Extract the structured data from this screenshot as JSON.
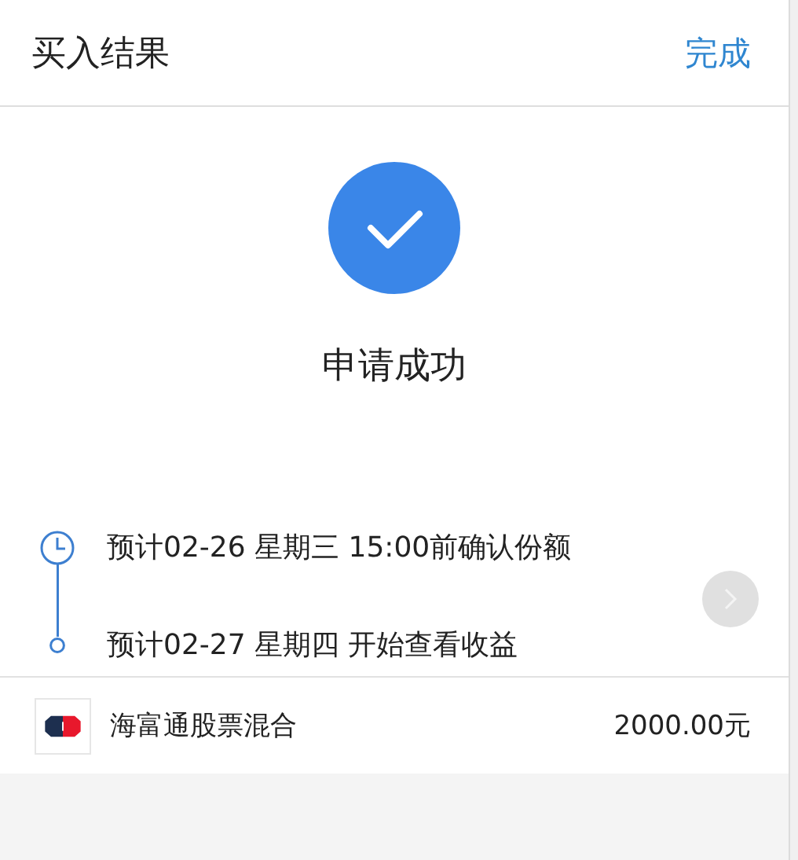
{
  "header": {
    "title": "买入结果",
    "done_button": "完成"
  },
  "result": {
    "status": "申请成功"
  },
  "timeline": [
    {
      "kind": "clock",
      "text": "预计02-26 星期三 15:00前确认份额"
    },
    {
      "kind": "dot",
      "text": "预计02-27 星期四 开始查看收益"
    }
  ],
  "fund": {
    "name": "海富通股票混合",
    "amount": "2000.00元"
  }
}
